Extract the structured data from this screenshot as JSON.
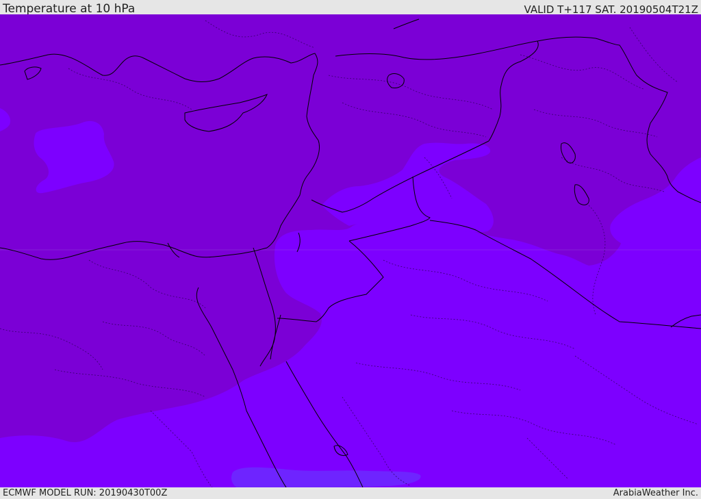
{
  "header": {
    "title": "Temperature at 10 hPa",
    "valid": "VALID T+117 SAT. 20190504T21Z"
  },
  "footer": {
    "model_run": "ECMWF MODEL RUN: 20190430T00Z",
    "credit": "ArabiaWeather Inc."
  },
  "map": {
    "field": "temperature",
    "level": "10 hPa",
    "colors": {
      "cooler_band": "#7b00d6",
      "warmer_band": "#7d00ff",
      "warmest_patch": "#6e24ff",
      "border_line": "#000000"
    }
  }
}
